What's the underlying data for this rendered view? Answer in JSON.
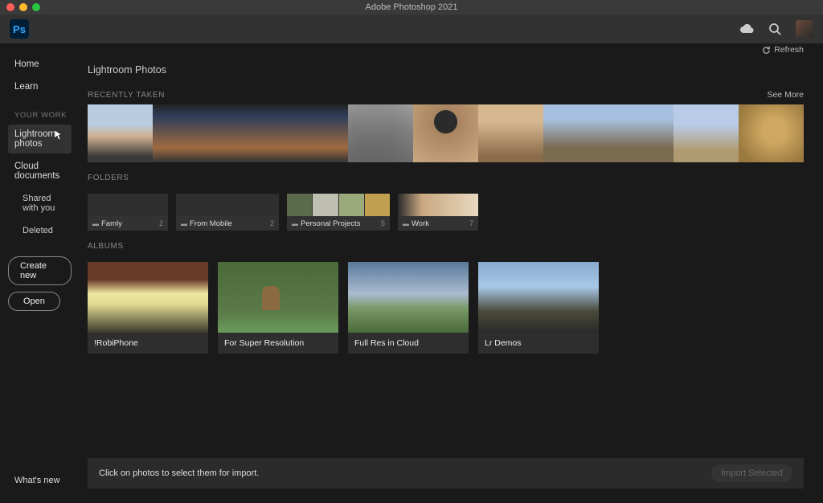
{
  "window": {
    "title": "Adobe Photoshop 2021"
  },
  "appbar": {
    "logo_text": "Ps"
  },
  "sidebar": {
    "items": [
      {
        "label": "Home"
      },
      {
        "label": "Learn"
      }
    ],
    "your_work_label": "YOUR WORK",
    "work_items": [
      {
        "label": "Lightroom photos",
        "active": true
      },
      {
        "label": "Cloud documents"
      },
      {
        "label": "Shared with you",
        "sub": true
      },
      {
        "label": "Deleted",
        "sub": true
      }
    ],
    "create_new": "Create new",
    "open": "Open",
    "whats_new": "What's new"
  },
  "main": {
    "refresh": "Refresh",
    "page_title": "Lightroom Photos",
    "sections": {
      "recent_label": "RECENTLY TAKEN",
      "see_more": "See More",
      "folders_label": "FOLDERS",
      "albums_label": "ALBUMS"
    },
    "folders": [
      {
        "name": "Famly",
        "count": 2
      },
      {
        "name": "From Mobile",
        "count": 2
      },
      {
        "name": "Personal Projects",
        "count": 5
      },
      {
        "name": "Work",
        "count": 7
      }
    ],
    "albums": [
      {
        "name": "!RobiPhone"
      },
      {
        "name": "For Super Resolution"
      },
      {
        "name": "Full Res in Cloud"
      },
      {
        "name": "Lr Demos"
      }
    ],
    "import_hint": "Click on photos to select them for import.",
    "import_button": "Import Selected"
  }
}
